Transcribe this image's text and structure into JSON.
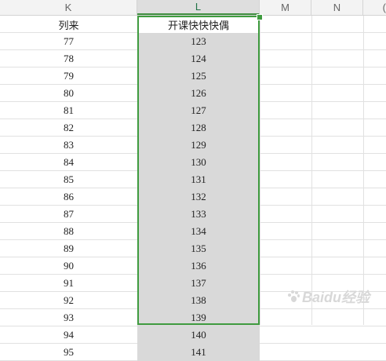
{
  "columns": {
    "prev_partial": "",
    "k": "K",
    "l": "L",
    "m": "M",
    "n": "N",
    "next_partial": "("
  },
  "headers": {
    "k": "列来",
    "l": "开课快快快偶"
  },
  "rows": [
    {
      "k": "77",
      "l": "123"
    },
    {
      "k": "78",
      "l": "124"
    },
    {
      "k": "79",
      "l": "125"
    },
    {
      "k": "80",
      "l": "126"
    },
    {
      "k": "81",
      "l": "127"
    },
    {
      "k": "82",
      "l": "128"
    },
    {
      "k": "83",
      "l": "129"
    },
    {
      "k": "84",
      "l": "130"
    },
    {
      "k": "85",
      "l": "131"
    },
    {
      "k": "86",
      "l": "132"
    },
    {
      "k": "87",
      "l": "133"
    },
    {
      "k": "88",
      "l": "134"
    },
    {
      "k": "89",
      "l": "135"
    },
    {
      "k": "90",
      "l": "136"
    },
    {
      "k": "91",
      "l": "137"
    },
    {
      "k": "92",
      "l": "138"
    },
    {
      "k": "93",
      "l": "139"
    },
    {
      "k": "94",
      "l": "140"
    },
    {
      "k": "95",
      "l": "141"
    }
  ],
  "watermark": {
    "text": "Baidu经验"
  },
  "colors": {
    "selection_border": "#3f9b3f",
    "selected_fill": "#d9d9d9",
    "column_header_bg": "#f3f3f3"
  }
}
